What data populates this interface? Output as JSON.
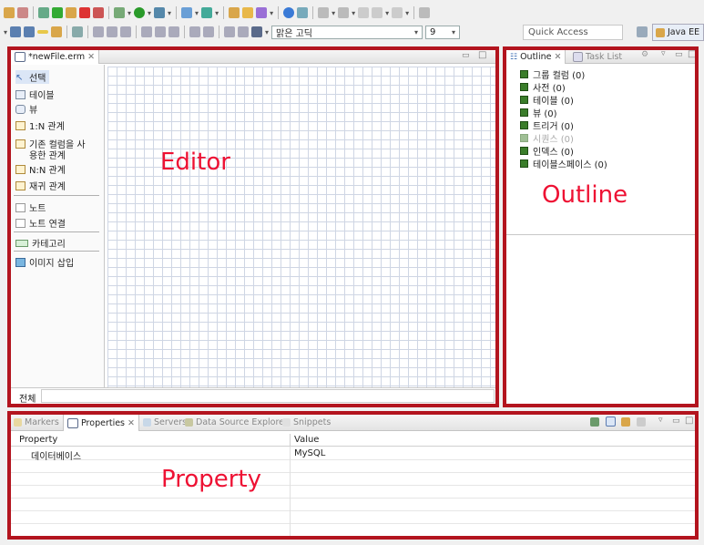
{
  "window": {
    "quick_access_placeholder": "Quick Access",
    "perspective_label": "Java EE"
  },
  "toolbar": {
    "font_name": "맑은 고딕",
    "font_size": "9"
  },
  "editor": {
    "tab_title": "*newFile.erm",
    "label": "Editor",
    "zoom_field_label": "전체",
    "palette": [
      {
        "label": "선택",
        "icon": "select-arrow-icon"
      },
      {
        "label": "테이블",
        "icon": "table-icon"
      },
      {
        "label": "뷰",
        "icon": "view-icon"
      },
      {
        "label": "1:N 관계",
        "icon": "relation-icon"
      },
      {
        "label": "기존 컬럼을 사",
        "icon": "relation-existing-icon"
      },
      {
        "label": "용한 관계"
      },
      {
        "label": "N:N 관계",
        "icon": "many-to-many-icon"
      },
      {
        "label": "재귀 관계",
        "icon": "self-relation-icon"
      },
      {
        "label": "노트",
        "icon": "note-icon"
      },
      {
        "label": "노트 연결",
        "icon": "note-connection-icon"
      },
      {
        "label": "카테고리",
        "icon": "category-icon"
      },
      {
        "label": "이미지 삽입",
        "icon": "image-icon"
      }
    ]
  },
  "outline": {
    "tabs": [
      {
        "label": "Outline",
        "active": true
      },
      {
        "label": "Task List",
        "active": false
      }
    ],
    "label": "Outline",
    "items": [
      {
        "label": "그룹 컬럼 (0)",
        "dim": false
      },
      {
        "label": "사전 (0)",
        "dim": false
      },
      {
        "label": "테이블 (0)",
        "dim": false
      },
      {
        "label": "뷰 (0)",
        "dim": false
      },
      {
        "label": "트리거 (0)",
        "dim": false
      },
      {
        "label": "시퀀스 (0)",
        "dim": true
      },
      {
        "label": "인덱스 (0)",
        "dim": false
      },
      {
        "label": "테이블스페이스 (0)",
        "dim": false
      }
    ]
  },
  "bottom": {
    "tabs": [
      {
        "label": "Markers",
        "active": false
      },
      {
        "label": "Properties",
        "active": true
      },
      {
        "label": "Servers",
        "active": false
      },
      {
        "label": "Data Source Explorer",
        "active": false
      },
      {
        "label": "Snippets",
        "active": false
      }
    ],
    "label": "Property",
    "columns": [
      "Property",
      "Value"
    ],
    "rows": [
      {
        "property": "데이터베이스",
        "value": "MySQL"
      }
    ]
  },
  "colors": {
    "annotation_red": "#ee1133",
    "frame_red": "#b3141e"
  }
}
